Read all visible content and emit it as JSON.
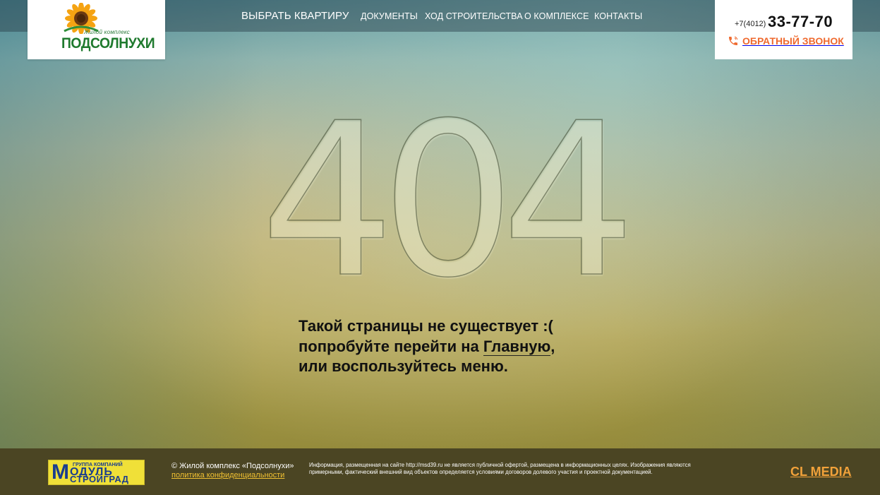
{
  "brand": {
    "logo_subtitle": "Жилой комплекс",
    "logo_name": "ПОДСОЛНУХИ"
  },
  "nav": {
    "items": [
      {
        "label": "ВЫБРАТЬ КВАРТИРУ"
      },
      {
        "label": "ДОКУМЕНТЫ"
      },
      {
        "label": "ХОД СТРОИТЕЛЬСТВА"
      },
      {
        "label": "О КОМПЛЕКСЕ"
      },
      {
        "label": "КОНТАКТЫ"
      }
    ]
  },
  "contact": {
    "phone_code": "+7(4012)",
    "phone_number": "33-77-70",
    "callback_label": "ОБРАТНЫЙ ЗВОНОК",
    "callback_icon": "phone-icon"
  },
  "error": {
    "code": "404",
    "line1": "Такой страницы не существует :(",
    "line2_prefix": "попробуйте перейти на ",
    "home_link": "Главную",
    "line2_suffix": ",",
    "line3": "или воспользуйтесь меню."
  },
  "footer": {
    "partner_group": "ГРУППА КОМПАНИЙ",
    "partner_letter": "М",
    "partner_name1": "ОДУЛЬ",
    "partner_name2": "СТРОЙГРАД",
    "copyright": "© Жилой комплекс «Подсолнухи»",
    "policy_link": "политика конфиденциальности",
    "disclaimer": "Информация, размещенная на сайте http://msd39.ru не является публичной офертой, размещена в информационных целях. Изображения являются примерными, фактический внешний вид объектов определяется условиями договоров долевого участия и проектной документацией.",
    "developer": "CL MEDIA"
  },
  "colors": {
    "accent": "#ef6a2f",
    "logo_green": "#1f7a2e",
    "footer_bg": "#4b4523",
    "policy_link": "#f0c032",
    "developer": "#f2a23a"
  }
}
